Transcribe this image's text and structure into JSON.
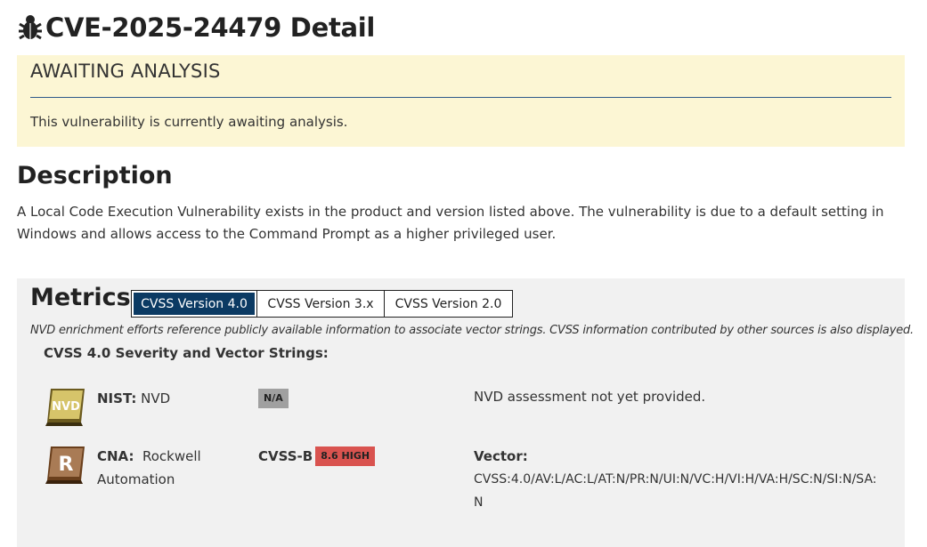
{
  "header": {
    "title": "CVE-2025-24479 Detail",
    "icon": "bug-icon"
  },
  "banner": {
    "heading": "AWAITING ANALYSIS",
    "text": "This vulnerability is currently awaiting analysis.",
    "background_color": "#fcf6d4"
  },
  "description": {
    "heading": "Description",
    "text": "A Local Code Execution Vulnerability exists in the product and version listed above. The vulnerability is due to a default setting in Windows and allows access to the Command Prompt as a higher privileged user."
  },
  "metrics": {
    "heading": "Metrics",
    "tabs": [
      {
        "label": "CVSS Version 4.0",
        "active": true
      },
      {
        "label": "CVSS Version 3.x",
        "active": false
      },
      {
        "label": "CVSS Version 2.0",
        "active": false
      }
    ],
    "note": "NVD enrichment efforts reference publicly available information to associate vector strings. CVSS information contributed by other sources is also displayed.",
    "subheading": "CVSS 4.0 Severity and Vector Strings:",
    "rows": [
      {
        "logo": "nvd-logo",
        "logo_text": "NVD",
        "source_label": "NIST:",
        "source_name": "NVD",
        "score_badge": "N/A",
        "assessment": "NVD assessment not yet provided."
      },
      {
        "logo": "cna-logo",
        "logo_text": "R",
        "source_label": "CNA:",
        "source_name": "Rockwell Automation",
        "score_label": "CVSS-B",
        "score_badge": "8.6 HIGH",
        "score_color": "#d9534f",
        "vector_label": "Vector:",
        "vector": "CVSS:4.0/AV:L/AC:L/AT:N/PR:N/UI:N/VC:H/VI:H/VA:H/SC:N/SI:N/SA:N"
      }
    ]
  }
}
